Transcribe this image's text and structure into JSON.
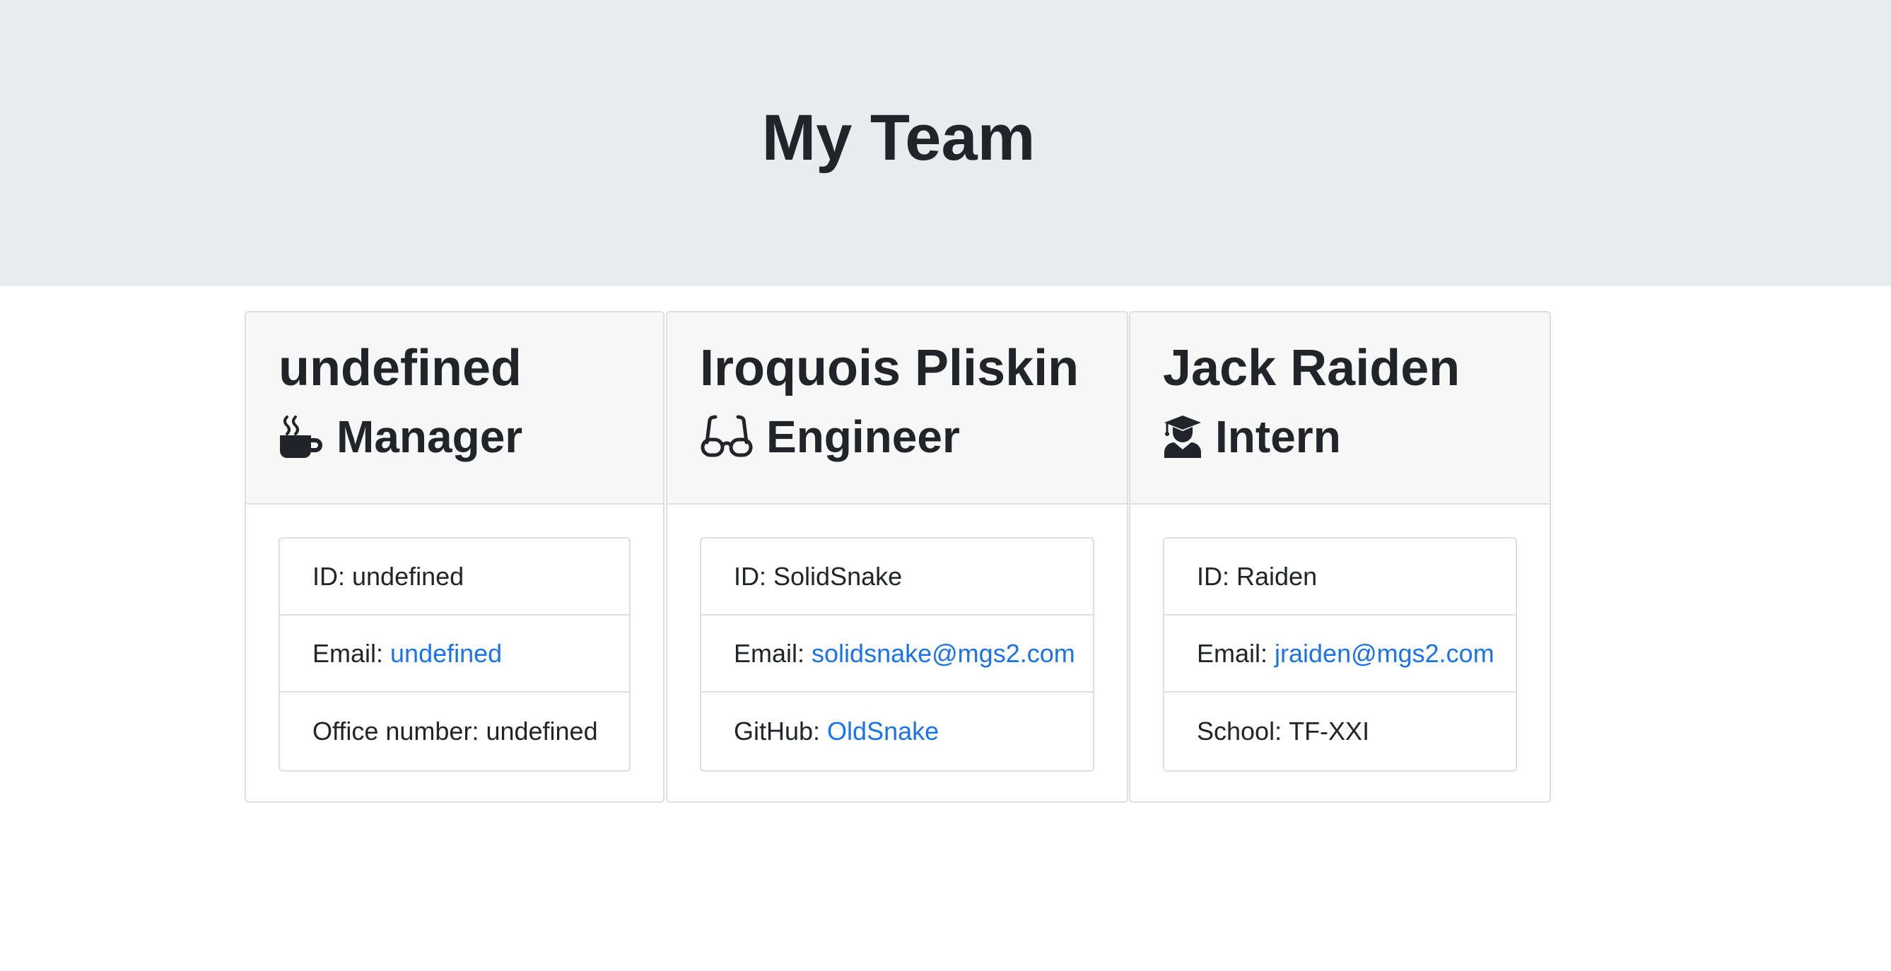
{
  "header": {
    "title": "My Team"
  },
  "colors": {
    "jumbotron_bg": "#e9ecef",
    "card_header_bg": "#f7f7f7",
    "link": "#1a73e8",
    "text": "#212529"
  },
  "cards": [
    {
      "name": "undefined",
      "role": "Manager",
      "icon": "coffee-mug-icon",
      "items": [
        {
          "label": "ID:",
          "value": "undefined"
        },
        {
          "label": "Email:",
          "link": "undefined"
        },
        {
          "label": "Office number:",
          "value": "undefined"
        }
      ]
    },
    {
      "name": "Iroquois Pliskin",
      "role": "Engineer",
      "icon": "glasses-icon",
      "items": [
        {
          "label": "ID:",
          "value": "SolidSnake"
        },
        {
          "label": "Email:",
          "link": "solidsnake@mgs2.com"
        },
        {
          "label": "GitHub:",
          "link": "OldSnake"
        }
      ]
    },
    {
      "name": "Jack Raiden",
      "role": "Intern",
      "icon": "graduate-icon",
      "items": [
        {
          "label": "ID:",
          "value": "Raiden"
        },
        {
          "label": "Email:",
          "link": "jraiden@mgs2.com"
        },
        {
          "label": "School:",
          "value": "TF-XXI"
        }
      ]
    }
  ]
}
